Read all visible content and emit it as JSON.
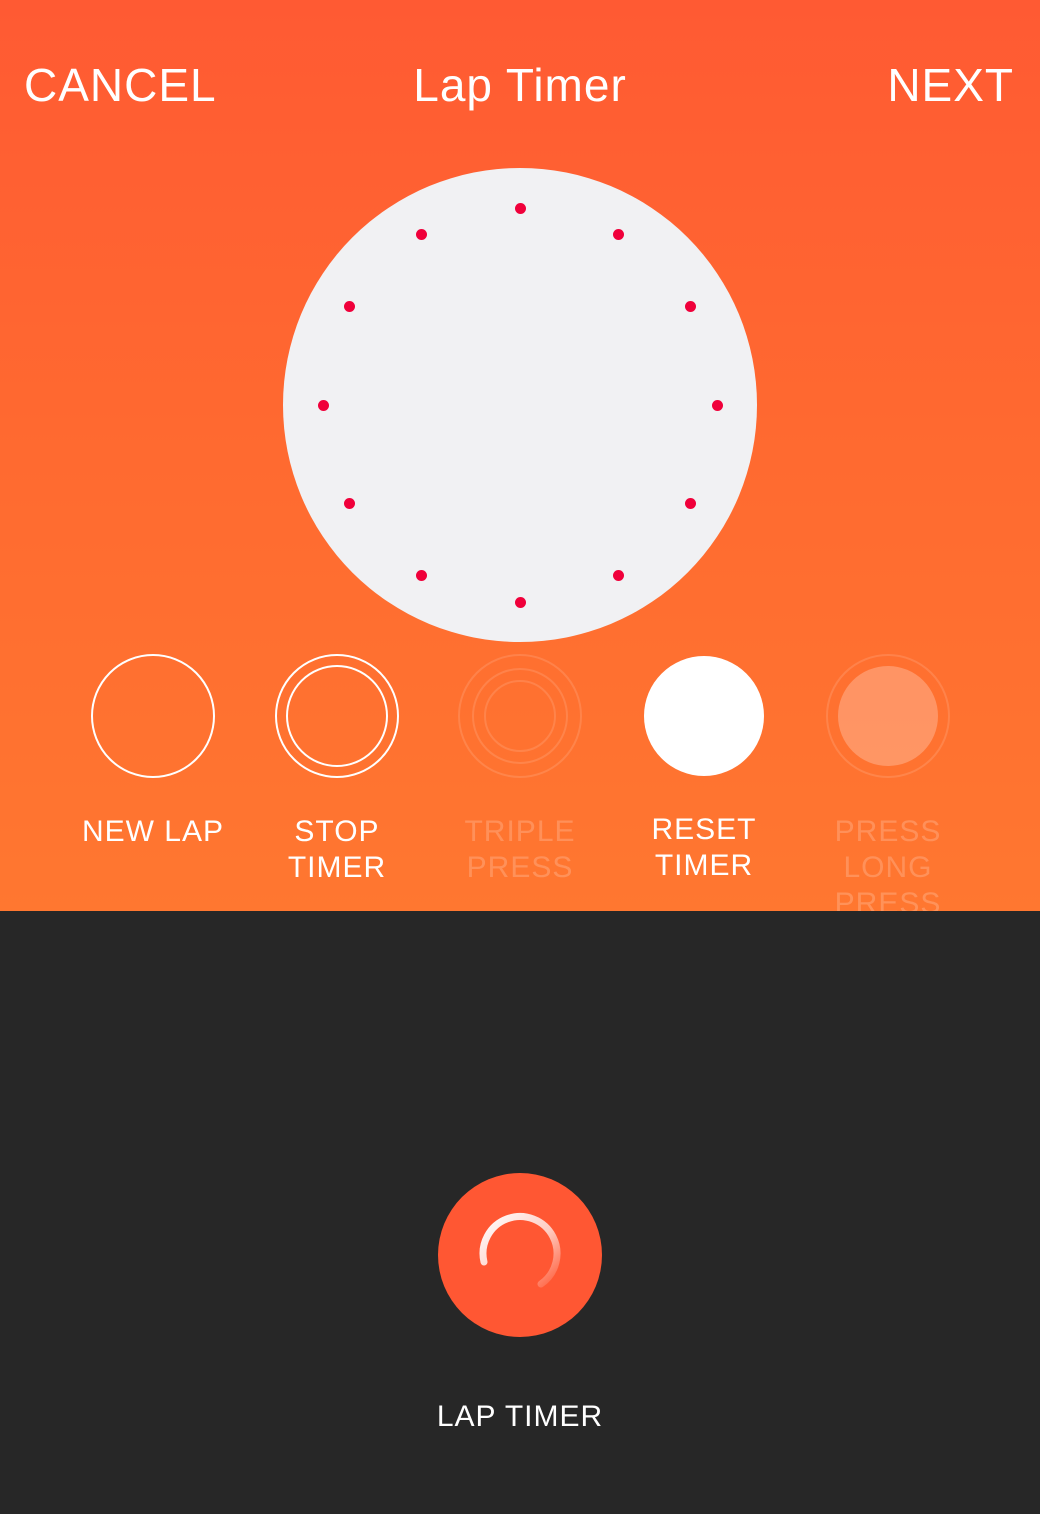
{
  "header": {
    "cancel_label": "CANCEL",
    "title": "Lap Timer",
    "next_label": "NEXT"
  },
  "device": {
    "led_color": "#f0003a",
    "led_count": 12
  },
  "gestures": [
    {
      "line1": "NEW LAP",
      "line2": "",
      "state": "active"
    },
    {
      "line1": "STOP",
      "line2": "TIMER",
      "state": "active"
    },
    {
      "line1": "TRIPLE",
      "line2": "PRESS",
      "state": "disabled"
    },
    {
      "line1": "RESET",
      "line2": "TIMER",
      "state": "active"
    },
    {
      "line1": "PRESS",
      "line2": "LONG",
      "line3": "PRESS",
      "state": "disabled"
    }
  ],
  "app": {
    "icon": "lap-timer-spinner-icon",
    "label": "LAP TIMER"
  },
  "colors": {
    "accent": "#ff5733",
    "gradient_top": "#ff5a33",
    "gradient_bottom": "#ff7730",
    "bottom_background": "#272727",
    "dial": "#f1f1f3"
  }
}
